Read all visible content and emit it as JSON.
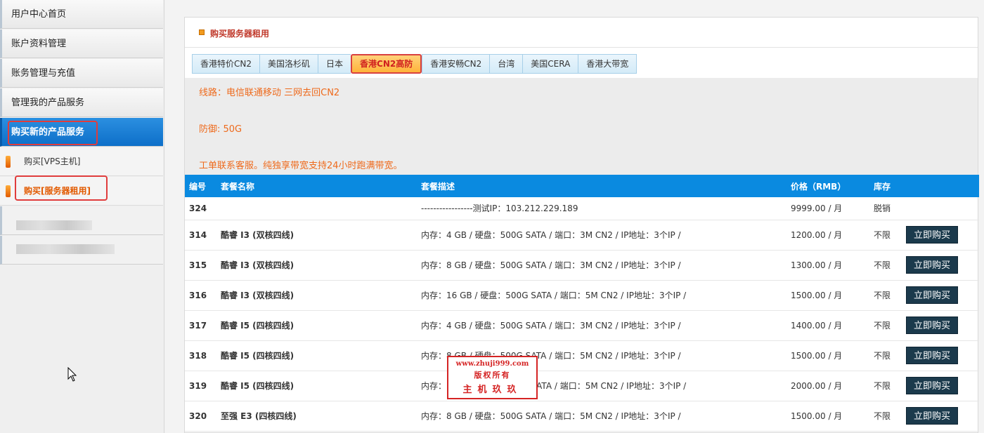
{
  "sidebar": {
    "items": [
      {
        "label": "用户中心首页"
      },
      {
        "label": "账户资料管理"
      },
      {
        "label": "账务管理与充值"
      },
      {
        "label": "管理我的产品服务"
      },
      {
        "label": "购买新的产品服务"
      }
    ],
    "subitems": [
      {
        "label": "购买[VPS主机]"
      },
      {
        "label": "购买[服务器租用]"
      }
    ]
  },
  "panel": {
    "title": "购买服务器租用"
  },
  "tabs": [
    {
      "label": "香港特价CN2"
    },
    {
      "label": "美国洛杉矶"
    },
    {
      "label": "日本"
    },
    {
      "label": "香港CN2高防"
    },
    {
      "label": "香港安畅CN2"
    },
    {
      "label": "台湾"
    },
    {
      "label": "美国CERA"
    },
    {
      "label": "香港大带宽"
    }
  ],
  "description": {
    "line1": "线路：电信联通移动 三网去回CN2",
    "line2": "防御: 50G",
    "line3": "工单联系客服。纯独享带宽支持24小时跑满带宽。"
  },
  "table": {
    "headers": {
      "id": "编号",
      "name": "套餐名称",
      "desc": "套餐描述",
      "price": "价格（RMB）",
      "stock": "库存"
    },
    "buy_label": "立即购买",
    "rows": [
      {
        "id": "324",
        "name": "",
        "desc": "-----------------测试IP：103.212.229.189",
        "price": "9999.00 / 月",
        "stock": "脱销",
        "buy": false
      },
      {
        "id": "314",
        "name": "酷睿 I3 (双核四线)",
        "desc": "内存：4 GB / 硬盘：500G SATA / 端口：3M CN2 / IP地址：3个IP /",
        "price": "1200.00 / 月",
        "stock": "不限",
        "buy": true
      },
      {
        "id": "315",
        "name": "酷睿 I3 (双核四线)",
        "desc": "内存：8 GB / 硬盘：500G SATA / 端口：3M CN2 / IP地址：3个IP /",
        "price": "1300.00 / 月",
        "stock": "不限",
        "buy": true
      },
      {
        "id": "316",
        "name": "酷睿 I3 (双核四线)",
        "desc": "内存：16 GB / 硬盘：500G SATA / 端口：5M CN2 / IP地址：3个IP /",
        "price": "1500.00 / 月",
        "stock": "不限",
        "buy": true
      },
      {
        "id": "317",
        "name": "酷睿 I5 (四核四线)",
        "desc": "内存：4 GB / 硬盘：500G SATA / 端口：3M CN2 / IP地址：3个IP /",
        "price": "1400.00 / 月",
        "stock": "不限",
        "buy": true
      },
      {
        "id": "318",
        "name": "酷睿 I5 (四核四线)",
        "desc": "内存：8 GB / 硬盘：500G SATA / 端口：5M CN2 / IP地址：3个IP /",
        "price": "1500.00 / 月",
        "stock": "不限",
        "buy": true
      },
      {
        "id": "319",
        "name": "酷睿 I5 (四核四线)",
        "desc": "内存：16 GB / 硬盘：500G SATA / 端口：5M CN2 / IP地址：3个IP /",
        "price": "2000.00 / 月",
        "stock": "不限",
        "buy": true
      },
      {
        "id": "320",
        "name": "至强 E3 (四核四线)",
        "desc": "内存：8 GB / 硬盘：500G SATA / 端口：5M CN2 / IP地址：3个IP /",
        "price": "1500.00 / 月",
        "stock": "不限",
        "buy": true
      }
    ]
  },
  "watermark": {
    "line1": "www.zhuji999.com",
    "line2": "版权所有",
    "line3": "主机玖玖"
  },
  "colors": {
    "accent_blue": "#0a8ae0",
    "active_tab": "#ffb33a",
    "highlight_red": "#e03c3c",
    "desc_orange": "#ee6a1c",
    "buy_button": "#1b3a4c"
  }
}
